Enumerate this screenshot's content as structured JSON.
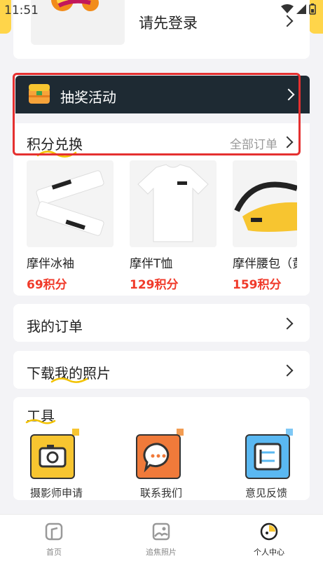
{
  "status_bar": {
    "time": "11:51"
  },
  "login": {
    "prompt": "请先登录"
  },
  "lottery": {
    "label": "抽奖活动"
  },
  "points": {
    "title": "积分兑换",
    "all_orders": "全部订单",
    "products": [
      {
        "name": "摩伴冰袖",
        "price": "69积分"
      },
      {
        "name": "摩伴T恤",
        "price": "129积分"
      },
      {
        "name": "摩伴腰包（黄",
        "price": "159积分"
      }
    ]
  },
  "my_orders": {
    "label": "我的订单"
  },
  "download_photos": {
    "label": "下载我的照片"
  },
  "tools": {
    "title": "工具",
    "items": [
      {
        "label": "摄影师申请",
        "icon": "camera-icon",
        "color": "#f7c530",
        "badge": "#f7c530"
      },
      {
        "label": "联系我们",
        "icon": "chat-icon",
        "color": "#f07a3a",
        "badge": "#f29c52"
      },
      {
        "label": "意见反馈",
        "icon": "feedback-icon",
        "color": "#5ab8f2",
        "badge": "#7ec8f5"
      }
    ]
  },
  "bottom_nav": [
    {
      "label": "首页",
      "icon": "home-icon"
    },
    {
      "label": "追焦照片",
      "icon": "photo-icon"
    },
    {
      "label": "个人中心",
      "icon": "profile-icon",
      "active": true
    }
  ],
  "colors": {
    "accent": "#ffd54a",
    "price": "#f03a2a",
    "dark_bar": "#1e2a33",
    "highlight": "#e53030"
  }
}
